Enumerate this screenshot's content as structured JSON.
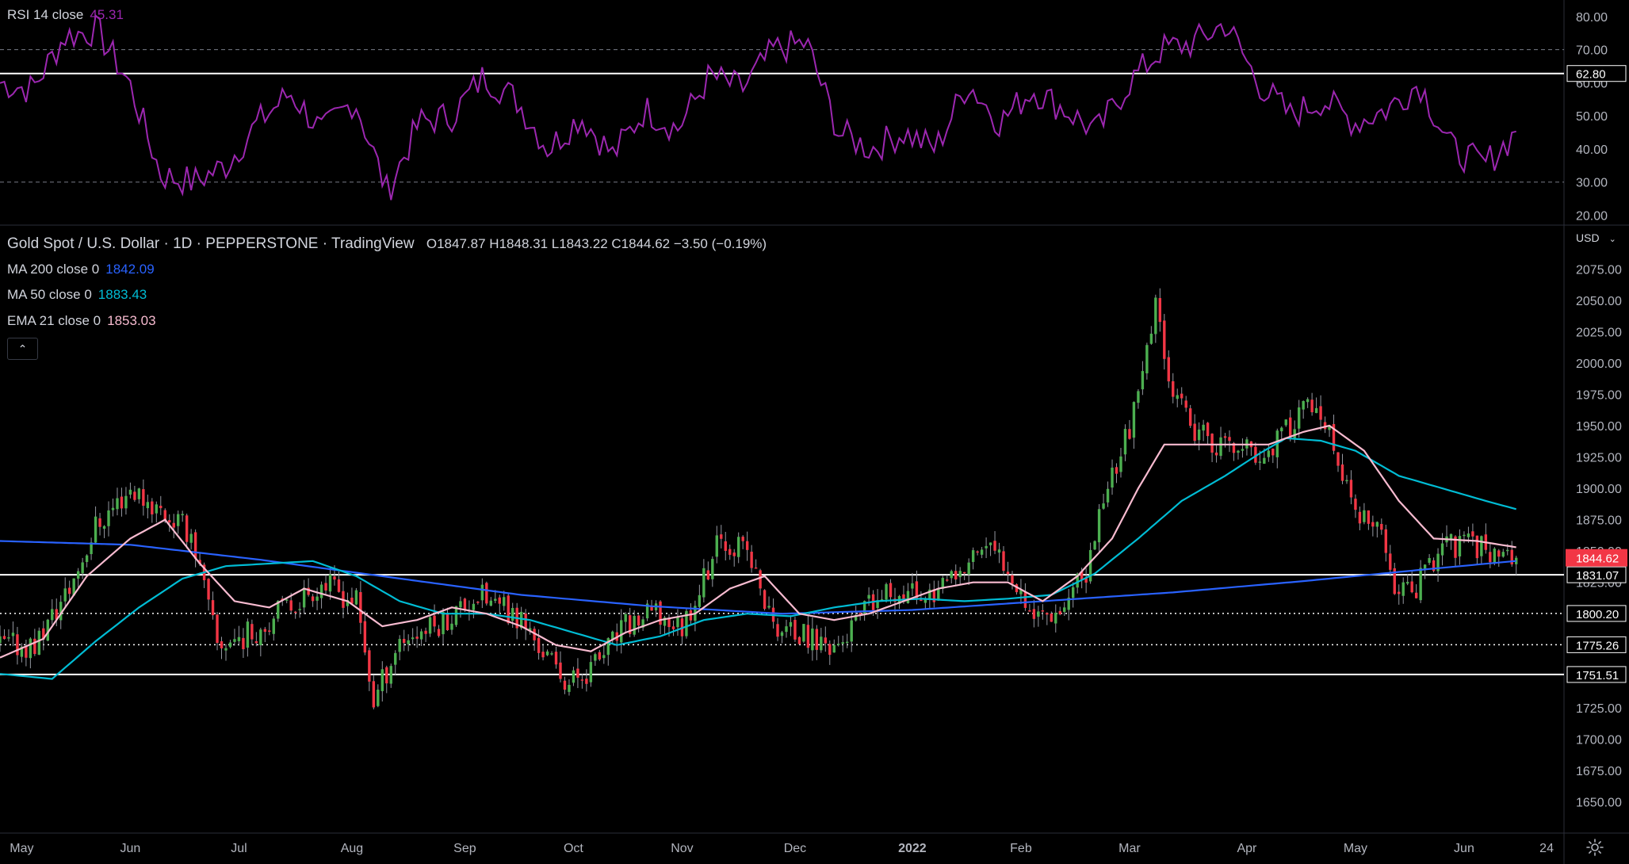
{
  "indicators": {
    "rsi": {
      "label": "RSI 14 close",
      "value": "45.31",
      "color": "#9c27b0"
    },
    "ma200": {
      "label": "MA 200 close 0",
      "value": "1842.09",
      "color": "#2962ff"
    },
    "ma50": {
      "label": "MA 50 close 0",
      "value": "1883.43",
      "color": "#00bcd4"
    },
    "ema21": {
      "label": "EMA 21 close 0",
      "value": "1853.03",
      "color": "#f8bbd0"
    }
  },
  "header": {
    "symbol": "Gold Spot / U.S. Dollar",
    "interval": "1D",
    "broker": "PEPPERSTONE",
    "source": "TradingView",
    "open": "O1847.87",
    "high": "H1848.31",
    "low": "L1843.22",
    "close": "C1844.62",
    "change": "−3.50 (−0.19%)"
  },
  "currency": "USD",
  "icons": {
    "collapse": "chevron-up-icon",
    "settings": "gear-icon"
  },
  "chart_data": [
    {
      "type": "line",
      "name": "RSI 14 close",
      "ylim": [
        17,
        85
      ],
      "y_ticks": [
        "80.00",
        "70.00",
        "60.00",
        "50.00",
        "40.00",
        "30.00",
        "20.00"
      ],
      "y_tick_values": [
        80,
        70,
        60,
        50,
        40,
        30,
        20
      ],
      "bands": [
        70,
        30
      ],
      "horizontal_line": {
        "value": 62.8,
        "label": "62.80"
      },
      "x": [
        0,
        6,
        13,
        20,
        27,
        32,
        38,
        44,
        50,
        56,
        64,
        72,
        80,
        88,
        96,
        104,
        112,
        120,
        128,
        136,
        144,
        152,
        160,
        168,
        176,
        184,
        190,
        196,
        204,
        212,
        220,
        228,
        236,
        244,
        252,
        260,
        268,
        276,
        284,
        292,
        300,
        308,
        316,
        324,
        332,
        340,
        349
      ],
      "values": [
        60,
        58,
        74,
        76,
        60,
        32,
        30,
        35,
        48,
        57,
        45,
        55,
        27,
        48,
        50,
        62,
        55,
        40,
        50,
        38,
        52,
        46,
        62,
        58,
        70,
        72,
        45,
        40,
        45,
        40,
        60,
        48,
        58,
        52,
        45,
        60,
        70,
        72,
        78,
        60,
        50,
        55,
        48,
        52,
        60,
        40,
        35,
        45
      ],
      "last_value": {
        "value": 45.31,
        "label": "45.31"
      }
    },
    {
      "type": "candlestick",
      "title": "Gold Spot / U.S. Dollar · 1D · PEPPERSTONE · TradingView",
      "ylim": [
        1625,
        2110
      ],
      "y_ticks": [
        "2075.00",
        "2050.00",
        "2025.00",
        "2000.00",
        "1975.00",
        "1950.00",
        "1925.00",
        "1900.00",
        "1875.00",
        "1850.00",
        "1825.00",
        "1800.00",
        "1775.00",
        "1750.00",
        "1725.00",
        "1700.00",
        "1675.00",
        "1650.00"
      ],
      "y_tick_values": [
        2075,
        2050,
        2025,
        2000,
        1975,
        1950,
        1925,
        1900,
        1875,
        1850,
        1825,
        1800,
        1775,
        1750,
        1725,
        1700,
        1675,
        1650
      ],
      "x_ticks": [
        "May",
        "Jun",
        "Jul",
        "Aug",
        "Sep",
        "Oct",
        "Nov",
        "Dec",
        "2022",
        "Feb",
        "Mar",
        "Apr",
        "May",
        "Jun",
        "24"
      ],
      "x_tick_days": [
        5,
        30,
        55,
        81,
        107,
        132,
        157,
        183,
        210,
        235,
        260,
        287,
        312,
        337,
        356
      ],
      "x_range_days": [
        0,
        360
      ],
      "price_path_days": [
        0,
        8,
        16,
        22,
        30,
        36,
        44,
        50,
        58,
        66,
        74,
        82,
        86,
        92,
        100,
        110,
        120,
        127,
        131,
        137,
        144,
        150,
        157,
        166,
        172,
        178,
        186,
        193,
        200,
        207,
        213,
        220,
        226,
        232,
        238,
        244,
        250,
        254,
        258,
        262,
        266,
        270,
        274,
        280,
        286,
        290,
        296,
        300,
        306,
        312,
        318,
        322,
        326,
        332,
        340,
        349
      ],
      "price_path": [
        1775,
        1775,
        1820,
        1870,
        1900,
        1885,
        1865,
        1775,
        1785,
        1805,
        1825,
        1810,
        1730,
        1780,
        1790,
        1815,
        1795,
        1760,
        1745,
        1760,
        1790,
        1800,
        1790,
        1860,
        1850,
        1790,
        1780,
        1775,
        1805,
        1820,
        1815,
        1825,
        1855,
        1840,
        1800,
        1805,
        1830,
        1895,
        1930,
        1970,
        2045,
        1980,
        1945,
        1935,
        1930,
        1925,
        1945,
        1970,
        1940,
        1880,
        1860,
        1815,
        1820,
        1855,
        1855,
        1845
      ],
      "series": [
        {
          "name": "MA 200 close 0",
          "x": [
            0,
            30,
            60,
            90,
            120,
            150,
            180,
            210,
            240,
            270,
            300,
            330,
            349
          ],
          "values": [
            1858,
            1855,
            1843,
            1829,
            1815,
            1806,
            1800,
            1803,
            1810,
            1817,
            1826,
            1836,
            1842.09
          ]
        },
        {
          "name": "MA 50 close 0",
          "x": [
            0,
            12,
            22,
            32,
            42,
            52,
            62,
            72,
            82,
            92,
            102,
            112,
            122,
            132,
            142,
            152,
            162,
            172,
            182,
            192,
            202,
            212,
            222,
            232,
            242,
            252,
            262,
            272,
            282,
            290,
            296,
            304,
            312,
            322,
            332,
            342,
            349
          ],
          "values": [
            1752,
            1748,
            1778,
            1805,
            1828,
            1838,
            1840,
            1842,
            1830,
            1810,
            1800,
            1800,
            1795,
            1785,
            1775,
            1782,
            1795,
            1800,
            1798,
            1805,
            1810,
            1812,
            1810,
            1812,
            1815,
            1832,
            1860,
            1890,
            1910,
            1928,
            1940,
            1938,
            1930,
            1910,
            1900,
            1890,
            1883.43
          ]
        },
        {
          "name": "EMA 21 close 0",
          "x": [
            0,
            10,
            20,
            30,
            38,
            46,
            54,
            62,
            70,
            80,
            88,
            96,
            104,
            112,
            120,
            128,
            136,
            144,
            152,
            160,
            168,
            176,
            184,
            192,
            200,
            208,
            216,
            224,
            232,
            240,
            248,
            256,
            262,
            268,
            276,
            284,
            292,
            300,
            306,
            314,
            322,
            330,
            340,
            349
          ],
          "values": [
            1765,
            1780,
            1830,
            1860,
            1875,
            1840,
            1810,
            1805,
            1820,
            1810,
            1790,
            1795,
            1805,
            1800,
            1790,
            1775,
            1770,
            1785,
            1795,
            1800,
            1820,
            1830,
            1800,
            1795,
            1800,
            1810,
            1820,
            1825,
            1825,
            1810,
            1830,
            1860,
            1900,
            1935,
            1935,
            1935,
            1935,
            1945,
            1950,
            1930,
            1890,
            1860,
            1858,
            1853.03
          ]
        }
      ],
      "horizontal_lines": [
        {
          "value": 1831.07,
          "label": "1831.07",
          "style": "solid"
        },
        {
          "value": 1800.2,
          "label": "1800.20",
          "style": "dotted"
        },
        {
          "value": 1775.26,
          "label": "1775.26",
          "style": "dotted"
        },
        {
          "value": 1751.51,
          "label": "1751.51",
          "style": "solid"
        }
      ],
      "last_price": {
        "value": 1844.62,
        "label": "1844.62",
        "color": "#f23645"
      },
      "candle_colors": {
        "up": "#4caf50",
        "down": "#f23645"
      }
    }
  ]
}
